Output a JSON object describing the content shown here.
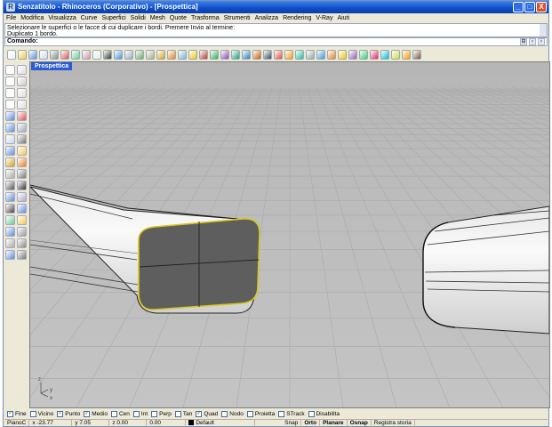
{
  "window": {
    "title": "Senzatitolo - Rhinoceros (Corporativo) - [Prospettica]",
    "buttons": {
      "minimize": "_",
      "maximize": "□",
      "close": "X"
    }
  },
  "menu": [
    "File",
    "Modifica",
    "Visualizza",
    "Curve",
    "Superfici",
    "Solidi",
    "Mesh",
    "Quote",
    "Trasforma",
    "Strumenti",
    "Analizza",
    "Rendering",
    "V-Ray",
    "Aiuti"
  ],
  "history": [
    "Selezionare le superfici o le facce di cui duplicare i bordi. Premere Invio al termine:",
    "Duplicato 1 bordo."
  ],
  "command": {
    "label": "Comando:",
    "value": ""
  },
  "viewport": {
    "label": "Prospettica",
    "axis_x": "x",
    "axis_y": "y",
    "axis_z": "z"
  },
  "osnaps": [
    {
      "label": "Fine",
      "checked": true
    },
    {
      "label": "Vicino",
      "checked": false
    },
    {
      "label": "Punto",
      "checked": true
    },
    {
      "label": "Medio",
      "checked": true
    },
    {
      "label": "Cen",
      "checked": false
    },
    {
      "label": "Int",
      "checked": false
    },
    {
      "label": "Perp",
      "checked": false
    },
    {
      "label": "Tan",
      "checked": false
    },
    {
      "label": "Quad",
      "checked": true
    },
    {
      "label": "Nodo",
      "checked": false
    },
    {
      "label": "Proietta",
      "checked": false
    },
    {
      "label": "STrack",
      "checked": false
    },
    {
      "label": "Disabilita",
      "checked": false
    }
  ],
  "status": {
    "cplane": "PianoC",
    "x": "x -23.77",
    "y": "y 7.05",
    "z": "z 0.00",
    "distance": "0.00",
    "layer": "Default",
    "snap": "Snap",
    "orto": "Orto",
    "planare": "Planare",
    "osnap": "Osnap",
    "history": "Registra storia"
  },
  "colors": {
    "title_bar": "#0f4cc7",
    "viewport_bg": "#bdbdbd",
    "selection": "#d9c61a",
    "viewport_tab": "#2c5bd6"
  }
}
